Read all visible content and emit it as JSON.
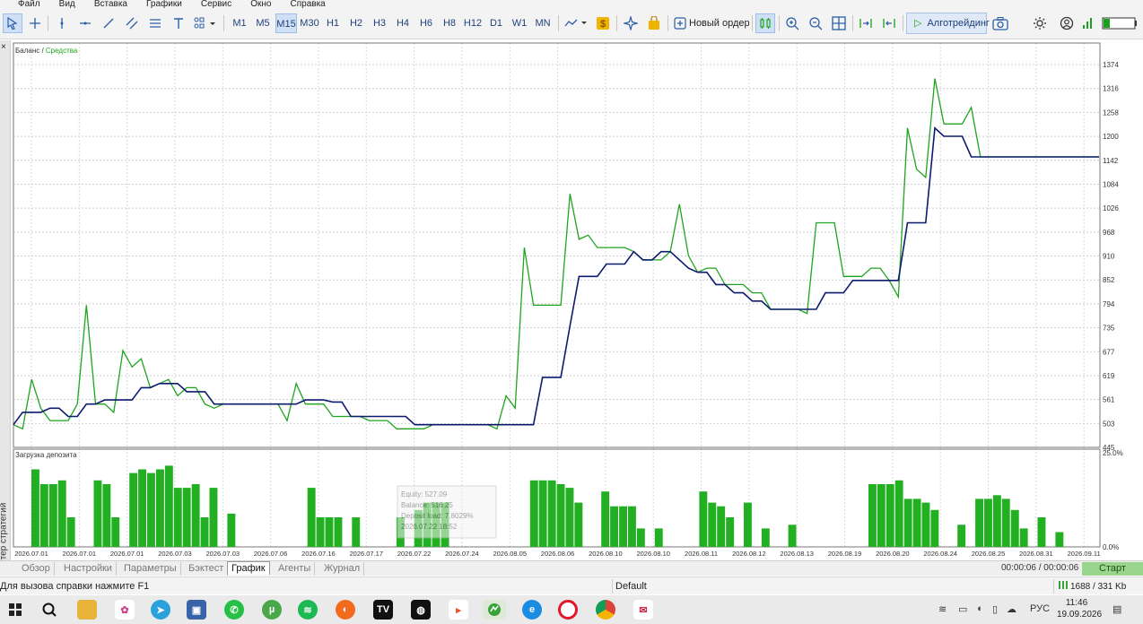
{
  "menu": [
    "Файл",
    "Вид",
    "Вставка",
    "Графики",
    "Сервис",
    "Окно",
    "Справка"
  ],
  "toolbar": {
    "timeframes": [
      "M1",
      "M5",
      "M15",
      "M30",
      "H1",
      "H2",
      "H3",
      "H4",
      "H6",
      "H8",
      "H12",
      "D1",
      "W1",
      "MN"
    ],
    "selected_timeframe": "M15",
    "new_order_label": "Новый ордер",
    "algo_label": "Алготрейдинг"
  },
  "side_panel": {
    "close": "×",
    "title": "Тестер стратегий"
  },
  "chart": {
    "legend_balance": "Баланс",
    "legend_separator": " / ",
    "legend_equity": "Средства",
    "deposit_title": "Загрузка депозита",
    "y_ticks": [
      "1374",
      "1316",
      "1258",
      "1200",
      "1142",
      "1084",
      "1026",
      "968",
      "910",
      "852",
      "794",
      "735",
      "677",
      "619",
      "561",
      "503",
      "445"
    ],
    "y_ticks_lower": [
      "25.0%",
      "0.0%"
    ],
    "x_labels": [
      "2026.07.01",
      "2026.07.01",
      "2026.07.01",
      "2026.07.03",
      "2026.07.03",
      "2026.07.06",
      "2026.07.16",
      "2026.07.17",
      "2026.07.22",
      "2026.07.24",
      "2026.08.05",
      "2026.08.06",
      "2026.08.10",
      "2026.08.10",
      "2026.08.11",
      "2026.08.12",
      "2026.08.13",
      "2026.08.19",
      "2026.08.20",
      "2026.08.24",
      "2026.08.25",
      "2026.08.31",
      "2026.09.11"
    ],
    "tooltip": [
      "Equity: 527.09",
      "Balance: 516.25",
      "Deposit load: 7.8029%",
      "2026.07.22 18:52"
    ]
  },
  "chart_data": [
    {
      "type": "line",
      "title": "",
      "ylim": [
        445,
        1374
      ],
      "series": [
        {
          "name": "Баланс",
          "color": "#0d1b6e",
          "values": [
            500,
            530,
            530,
            530,
            540,
            540,
            520,
            520,
            550,
            550,
            560,
            560,
            560,
            560,
            590,
            590,
            600,
            600,
            600,
            580,
            580,
            580,
            550,
            550,
            550,
            550,
            550,
            550,
            550,
            550,
            550,
            550,
            560,
            560,
            560,
            555,
            555,
            520,
            520,
            520,
            520,
            520,
            520,
            520,
            500,
            500,
            500,
            500,
            500,
            500,
            500,
            500,
            500,
            500,
            500,
            500,
            500,
            500,
            615,
            615,
            615,
            740,
            860,
            860,
            860,
            890,
            890,
            890,
            920,
            900,
            900,
            920,
            920,
            900,
            880,
            870,
            870,
            840,
            840,
            820,
            820,
            800,
            800,
            780,
            780,
            780,
            780,
            780,
            780,
            820,
            820,
            820,
            850,
            850,
            850,
            850,
            850,
            850,
            990,
            990,
            990,
            1220,
            1200,
            1200,
            1200,
            1150,
            1150,
            1150,
            1150,
            1150,
            1150,
            1150,
            1150,
            1150,
            1150,
            1150,
            1150,
            1150,
            1150,
            1150
          ]
        },
        {
          "name": "Средства",
          "color": "#1fa41f",
          "values": [
            500,
            490,
            610,
            540,
            510,
            510,
            510,
            550,
            790,
            550,
            550,
            530,
            680,
            640,
            660,
            590,
            600,
            610,
            570,
            590,
            590,
            550,
            540,
            550,
            550,
            550,
            550,
            550,
            550,
            550,
            510,
            600,
            550,
            550,
            550,
            520,
            520,
            520,
            520,
            510,
            510,
            510,
            490,
            490,
            490,
            490,
            500,
            500,
            500,
            500,
            500,
            500,
            500,
            490,
            570,
            540,
            930,
            790,
            790,
            790,
            790,
            1060,
            950,
            960,
            930,
            930,
            930,
            930,
            920,
            900,
            900,
            900,
            920,
            1035,
            910,
            870,
            880,
            880,
            840,
            840,
            840,
            820,
            820,
            780,
            780,
            780,
            780,
            770,
            990,
            990,
            990,
            860,
            860,
            860,
            880,
            880,
            850,
            810,
            1220,
            1120,
            1100,
            1340,
            1230,
            1230,
            1230,
            1270,
            1150,
            1150,
            1150,
            1150,
            1150,
            1150,
            1150,
            1150,
            1150,
            1150,
            1150,
            1150,
            1150,
            1150
          ]
        }
      ]
    },
    {
      "type": "bar",
      "title": "Загрузка депозита",
      "ylim": [
        0,
        25
      ],
      "values": [
        21,
        17,
        17,
        18,
        8,
        0,
        0,
        18,
        17,
        8,
        0,
        20,
        21,
        20,
        21,
        22,
        16,
        16,
        17,
        8,
        16,
        0,
        9,
        0,
        0,
        0,
        0,
        0,
        0,
        0,
        0,
        16,
        8,
        8,
        8,
        0,
        8,
        0,
        0,
        0,
        0,
        8,
        0,
        10,
        12,
        12,
        12,
        0,
        0,
        0,
        0,
        0,
        0,
        0,
        0,
        0,
        18,
        18,
        18,
        17,
        16,
        12,
        0,
        0,
        15,
        11,
        11,
        11,
        5,
        0,
        5,
        0,
        0,
        0,
        0,
        15,
        12,
        11,
        8,
        0,
        12,
        0,
        5,
        0,
        0,
        6,
        0,
        0,
        0,
        0,
        0,
        0,
        0,
        0,
        17,
        17,
        17,
        18,
        13,
        13,
        12,
        10,
        0,
        0,
        6,
        0,
        13,
        13,
        14,
        13,
        10,
        5,
        0,
        8,
        0,
        4,
        0,
        0,
        0,
        0
      ]
    }
  ],
  "tabs": {
    "items": [
      "Обзор",
      "Настройки",
      "Параметры",
      "Бэктест",
      "График",
      "Агенты",
      "Журнал"
    ],
    "active": "График",
    "timer": "00:00:06 / 00:00:06",
    "start_label": "Старт"
  },
  "status": {
    "help": "Для вызова справки нажмите F1",
    "profile": "Default",
    "network": "1688 / 331 Kb"
  },
  "taskbar": {
    "lang": "РУС",
    "time": "11:46",
    "date": "19.09.2026"
  },
  "colors": {
    "balance": "#0d1b6e",
    "equity": "#1fa41f",
    "bars": "#22b022",
    "accent": "#2b5ea7"
  }
}
